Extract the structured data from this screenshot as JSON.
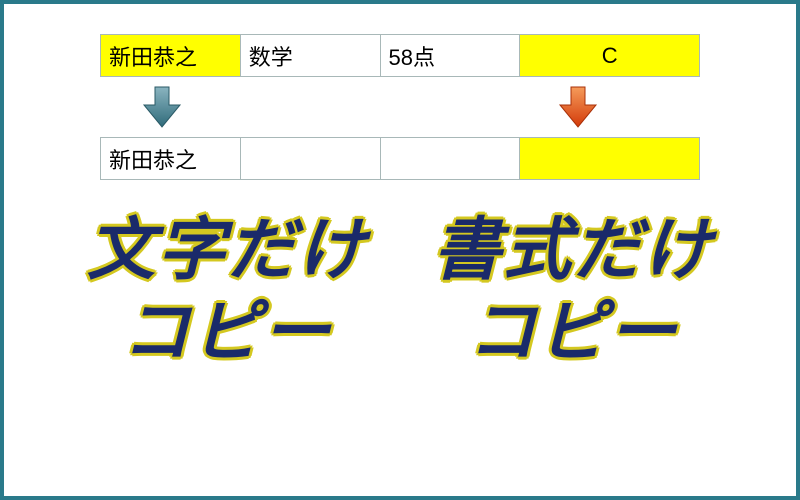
{
  "top_row": {
    "name": "新田恭之",
    "subject": "数学",
    "score": "58点",
    "grade": "C"
  },
  "bottom_row": {
    "name": "新田恭之",
    "subject": "",
    "score": "",
    "grade": ""
  },
  "captions": {
    "left_line1": "文字だけ",
    "left_line2": "コピー",
    "right_line1": "書式だけ",
    "right_line2": "コピー"
  },
  "colors": {
    "highlight": "#ffff00",
    "border": "#2a7a8a",
    "text_main": "#1a2a6a",
    "text_outline": "#d4c820",
    "arrow_left": "#5a8899",
    "arrow_right": "#e25a1a"
  }
}
